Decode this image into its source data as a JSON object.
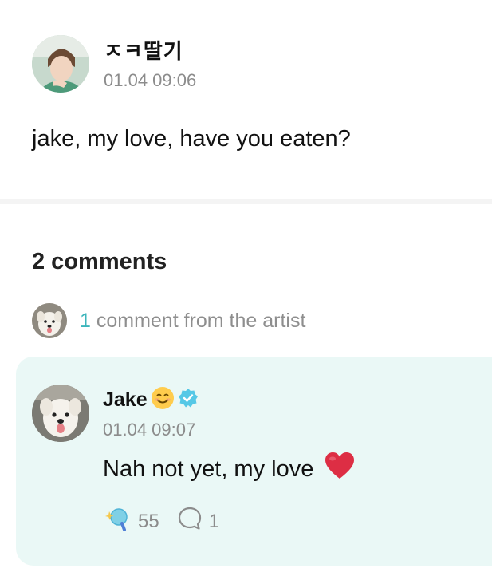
{
  "post": {
    "author": "ㅈㅋ딸기",
    "timestamp": "01.04 09:06",
    "body": "jake, my love, have you eaten?"
  },
  "comments": {
    "count_label": "2 comments",
    "artist_count": "1",
    "artist_label": " comment from the artist"
  },
  "artist_comment": {
    "author": "Jake",
    "author_emoji_icon": "smiling-face-emoji-icon",
    "badge_icon": "verified-badge-icon",
    "timestamp": "01.04 09:07",
    "body": "Nah not yet, my love",
    "body_emoji_icon": "red-heart-emoji-icon",
    "reaction_count": "55",
    "reply_count": "1"
  },
  "colors": {
    "accent": "#3cb5bb",
    "card_background": "#eaf8f6",
    "muted_text": "#8c8c8c",
    "verified_badge": "#56c8e6"
  }
}
